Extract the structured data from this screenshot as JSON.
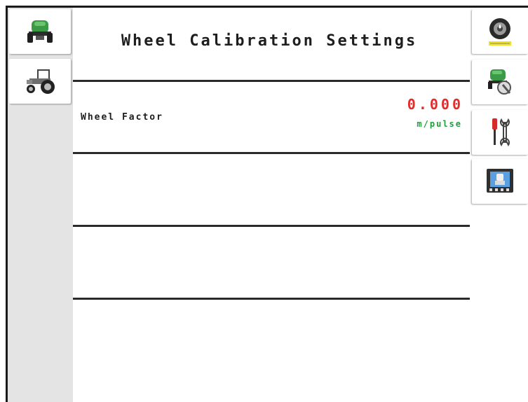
{
  "header": {
    "title": "Wheel Calibration Settings"
  },
  "left_tabs": [
    {
      "icon": "implement-icon"
    },
    {
      "icon": "tractor-icon"
    }
  ],
  "right_tabs": [
    {
      "icon": "wheel-sensor-icon"
    },
    {
      "icon": "implement-tools-icon"
    },
    {
      "icon": "screwdriver-wrench-icon"
    },
    {
      "icon": "display-screen-icon"
    }
  ],
  "settings": [
    {
      "label": "Wheel Factor",
      "value": "0.000",
      "unit": "m/pulse"
    }
  ],
  "colors": {
    "value": "#e52b2b",
    "unit": "#1f9e3a",
    "implement_green": "#3a9a46",
    "rail": "#e4e4e4"
  }
}
